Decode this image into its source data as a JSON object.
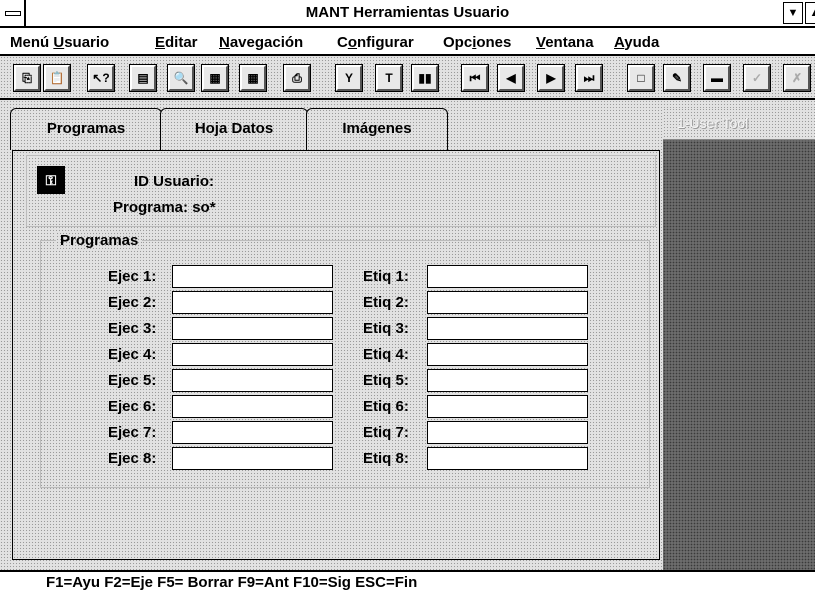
{
  "window": {
    "title": "MANT Herramientas Usuario",
    "min_glyph": "▼",
    "max_glyph": "▲"
  },
  "menubar": [
    {
      "pre": "Menú ",
      "u": "U",
      "post": "suario"
    },
    {
      "pre": "",
      "u": "E",
      "post": "ditar"
    },
    {
      "pre": "",
      "u": "N",
      "post": "avegación"
    },
    {
      "pre": "C",
      "u": "o",
      "post": "nfigurar"
    },
    {
      "pre": "Opc",
      "u": "i",
      "post": "ones"
    },
    {
      "pre": "",
      "u": "V",
      "post": "entana"
    },
    {
      "pre": "",
      "u": "A",
      "post": "yuda"
    }
  ],
  "toolbar": [
    {
      "icon": "copy-icon",
      "glyph": "⎘"
    },
    {
      "icon": "paste-icon",
      "glyph": "📋"
    },
    {
      "icon": "help-cursor-icon",
      "glyph": "↖?"
    },
    {
      "icon": "notes-icon",
      "glyph": "▤"
    },
    {
      "icon": "zoom-icon",
      "glyph": "🔍"
    },
    {
      "icon": "grid-icon",
      "glyph": "▦"
    },
    {
      "icon": "table-icon",
      "glyph": "▦"
    },
    {
      "icon": "print-icon",
      "glyph": "⎙"
    },
    {
      "icon": "filter-icon",
      "glyph": "Y"
    },
    {
      "icon": "text-icon",
      "glyph": "T"
    },
    {
      "icon": "chart-icon",
      "glyph": "▮▮"
    },
    {
      "icon": "first-record-icon",
      "glyph": "⏮"
    },
    {
      "icon": "previous-record-icon",
      "glyph": "◀"
    },
    {
      "icon": "next-record-icon",
      "glyph": "▶"
    },
    {
      "icon": "last-record-icon",
      "glyph": "⏭"
    },
    {
      "icon": "new-record-icon",
      "glyph": "□"
    },
    {
      "icon": "edit-icon",
      "glyph": "✎"
    },
    {
      "icon": "delete-icon",
      "glyph": "▬"
    },
    {
      "icon": "accept-icon",
      "glyph": "✓"
    },
    {
      "icon": "cancel-icon",
      "glyph": "✗"
    }
  ],
  "tabs": [
    "Programas",
    "Hoja Datos",
    "Imágenes"
  ],
  "right_pane": {
    "title": "1-User Tool"
  },
  "info": {
    "id_label": "ID Usuario:",
    "program_label": "Programa: so*"
  },
  "programs": {
    "title": "Programas",
    "exec_labels": [
      "Ejec 1:",
      "Ejec 2:",
      "Ejec 3:",
      "Ejec 4:",
      "Ejec 5:",
      "Ejec 6:",
      "Ejec 7:",
      "Ejec 8:"
    ],
    "tag_labels": [
      "Etiq 1:",
      "Etiq 2:",
      "Etiq 3:",
      "Etiq 4:",
      "Etiq 5:",
      "Etiq 6:",
      "Etiq 7:",
      "Etiq 8:"
    ],
    "exec_values": [
      "",
      "",
      "",
      "",
      "",
      "",
      "",
      ""
    ],
    "tag_values": [
      "",
      "",
      "",
      "",
      "",
      "",
      "",
      ""
    ]
  },
  "status": {
    "text": "F1=Ayu  F2=Eje  F5= Borrar  F9=Ant  F10=Sig  ESC=Fin"
  }
}
